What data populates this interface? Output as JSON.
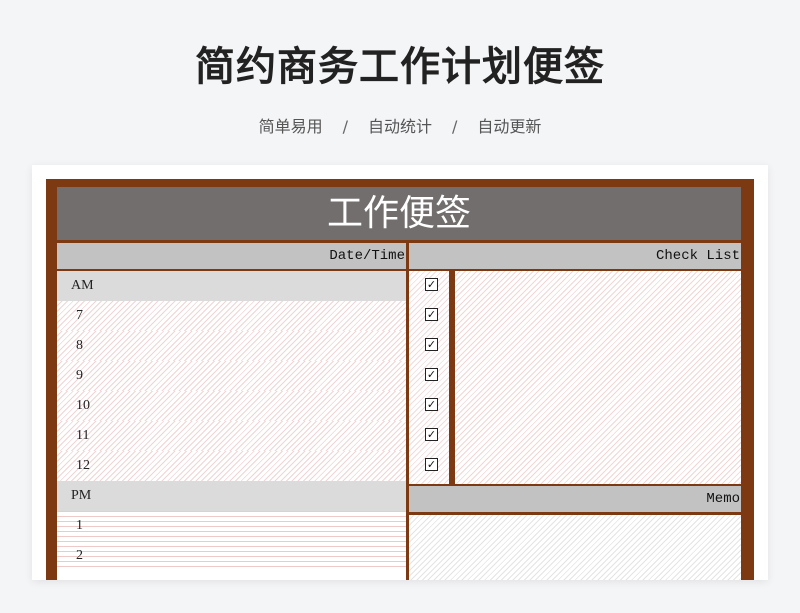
{
  "header": {
    "title": "简约商务工作计划便签",
    "tags": [
      "简单易用",
      "自动统计",
      "自动更新"
    ],
    "separator": "/"
  },
  "sheet": {
    "banner": "工作便签",
    "date_time_label": "Date/Time",
    "check_list_label": "Check List",
    "memo_label": "Memo",
    "am_label": "AM",
    "pm_label": "PM",
    "am_hours": [
      "7",
      "8",
      "9",
      "10",
      "11",
      "12"
    ],
    "pm_hours": [
      "1",
      "2"
    ],
    "check_mark": "✓",
    "checked_count": 7
  },
  "colors": {
    "frame": "#7d3a12",
    "banner": "#716e6d",
    "header_bar": "#c3c2c2",
    "section_bar": "#dcdbdb"
  }
}
